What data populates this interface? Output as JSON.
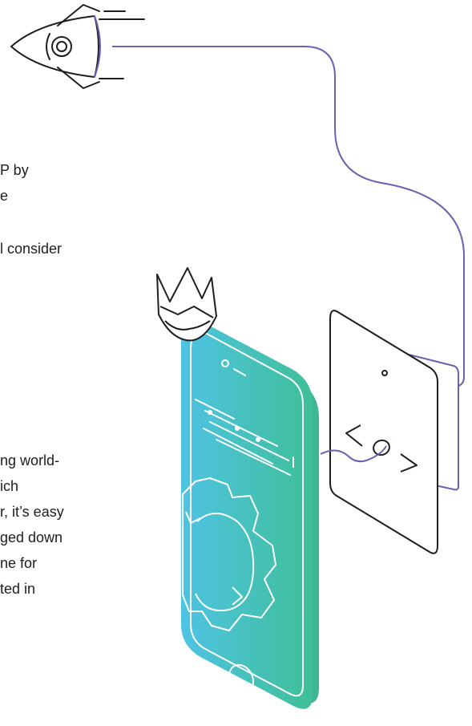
{
  "text_fragments": [
    "P by",
    "e",
    "l consider",
    "ng world-",
    "ich",
    "r, it’s easy",
    "ged down",
    "ne for",
    "ted in"
  ],
  "colors": {
    "line_purple": "#6f5fb0",
    "outline_dark": "#1e1e1e",
    "phone_gradient_start": "#4fc3e4",
    "phone_gradient_end": "#3fbf97"
  },
  "icons": {
    "rocket": "rocket-icon",
    "crown": "crown-icon",
    "phone": "smartphone-icon",
    "gear": "gear-icon",
    "tablet": "tablet-icon",
    "code": "code-brackets-icon"
  }
}
